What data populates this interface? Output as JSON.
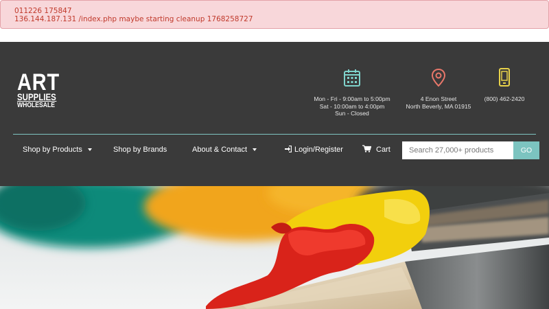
{
  "debug": {
    "line1": "011226 175847",
    "line2": "136.144.187.131 /index.php maybe starting cleanup 1768258727"
  },
  "logo": {
    "word1": "ART",
    "word2": "SUPPLIES",
    "word3": "WHOLESALE"
  },
  "contact": {
    "hours": [
      "Mon - Fri - 9:00am to 5:00pm",
      "Sat - 10:00am to 4:00pm",
      "Sun - Closed"
    ],
    "address": [
      "4 Enon Street",
      "North Beverly, MA 01915"
    ],
    "phone": "(800) 462-2420",
    "icons": [
      "calendar-icon",
      "map-pin-icon",
      "phone-icon"
    ]
  },
  "nav": {
    "products": "Shop by Products",
    "brands": "Shop by Brands",
    "about": "About & Contact",
    "login": "Login/Register",
    "cart": "Cart"
  },
  "search": {
    "placeholder": "Search 27,000+ products",
    "button": "GO"
  },
  "colors": {
    "header_bg": "#3a3a3a",
    "accent_teal": "#7cc4c0",
    "calendar_icon": "#7fd3cc",
    "pin_icon": "#e8776a",
    "phone_icon": "#e8d24a",
    "debug_text": "#c0392b",
    "debug_bg": "#f8d7da"
  }
}
